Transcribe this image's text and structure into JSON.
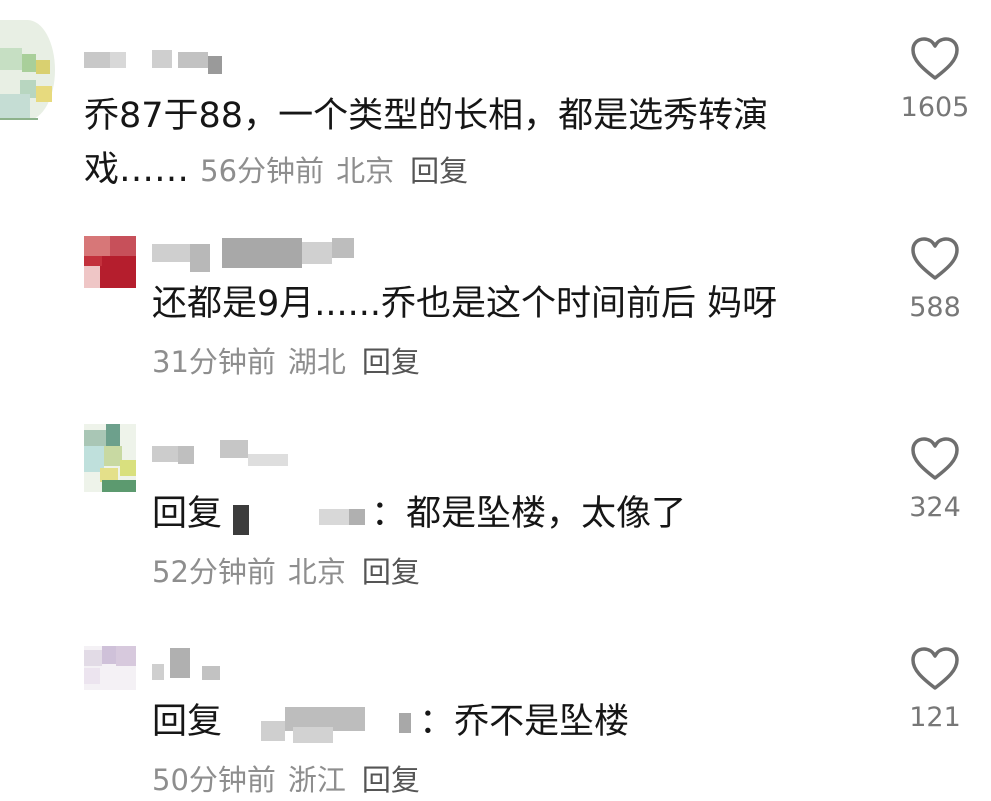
{
  "comments": [
    {
      "text_line1": "乔87于88，一个类型的长相，都是选秀转演",
      "text_line2": "戏……",
      "time": "56分钟前",
      "location": "北京",
      "reply_label": "回复",
      "likes": "1605"
    },
    {
      "text": "还都是9月......乔也是这个时间前后 妈呀",
      "time": "31分钟前",
      "location": "湖北",
      "reply_label": "回复",
      "likes": "588"
    },
    {
      "reply_prefix": "回复",
      "text": "：都是坠楼，太像了",
      "time": "52分钟前",
      "location": "北京",
      "reply_label": "回复",
      "likes": "324"
    },
    {
      "reply_prefix": "回复",
      "text": "：乔不是坠楼",
      "time": "50分钟前",
      "location": "浙江",
      "reply_label": "回复",
      "likes": "121"
    }
  ],
  "colors": {
    "text": "#161616",
    "meta": "#8e8e8e",
    "icon": "#6e6e6e",
    "background": "#ffffff"
  },
  "icons": {
    "like": "heart-outline-icon"
  }
}
